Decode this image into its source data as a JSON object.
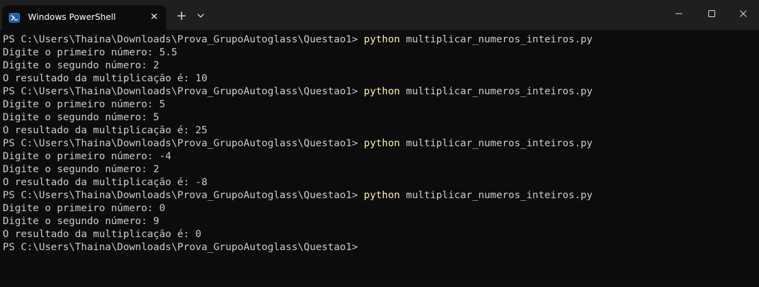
{
  "window": {
    "tab_title": "Windows PowerShell",
    "icons": {
      "tab": "powershell-icon",
      "close_tab": "close-icon",
      "new_tab": "plus-icon",
      "dropdown": "chevron-down-icon",
      "minimize": "minimize-icon",
      "maximize": "maximize-icon",
      "close_window": "close-icon"
    },
    "tab_close_glyph": "✕",
    "new_tab_glyph": "+"
  },
  "colors": {
    "background": "#0c0c0c",
    "titlebar": "#1f1f1f",
    "text": "#cccccc",
    "command": "#f9f1a5"
  },
  "terminal": {
    "lines": [
      {
        "kind": "prompt",
        "prompt": "PS C:\\Users\\Thaina\\Downloads\\Prova_GrupoAutoglass\\Questao1> ",
        "command": "python",
        "args": " multiplicar_numeros_inteiros.py"
      },
      {
        "kind": "output",
        "text": "Digite o primeiro número: 5.5"
      },
      {
        "kind": "output",
        "text": "Digite o segundo número: 2"
      },
      {
        "kind": "output",
        "text": "O resultado da multiplicação é: 10"
      },
      {
        "kind": "prompt",
        "prompt": "PS C:\\Users\\Thaina\\Downloads\\Prova_GrupoAutoglass\\Questao1> ",
        "command": "python",
        "args": " multiplicar_numeros_inteiros.py"
      },
      {
        "kind": "output",
        "text": "Digite o primeiro número: 5"
      },
      {
        "kind": "output",
        "text": "Digite o segundo número: 5"
      },
      {
        "kind": "output",
        "text": "O resultado da multiplicação é: 25"
      },
      {
        "kind": "prompt",
        "prompt": "PS C:\\Users\\Thaina\\Downloads\\Prova_GrupoAutoglass\\Questao1> ",
        "command": "python",
        "args": " multiplicar_numeros_inteiros.py"
      },
      {
        "kind": "output",
        "text": "Digite o primeiro número: -4"
      },
      {
        "kind": "output",
        "text": "Digite o segundo número: 2"
      },
      {
        "kind": "output",
        "text": "O resultado da multiplicação é: -8"
      },
      {
        "kind": "prompt",
        "prompt": "PS C:\\Users\\Thaina\\Downloads\\Prova_GrupoAutoglass\\Questao1> ",
        "command": "python",
        "args": " multiplicar_numeros_inteiros.py"
      },
      {
        "kind": "output",
        "text": "Digite o primeiro número: 0"
      },
      {
        "kind": "output",
        "text": "Digite o segundo número: 9"
      },
      {
        "kind": "output",
        "text": "O resultado da multiplicação é: 0"
      },
      {
        "kind": "prompt",
        "prompt": "PS C:\\Users\\Thaina\\Downloads\\Prova_GrupoAutoglass\\Questao1>",
        "command": "",
        "args": ""
      }
    ]
  }
}
